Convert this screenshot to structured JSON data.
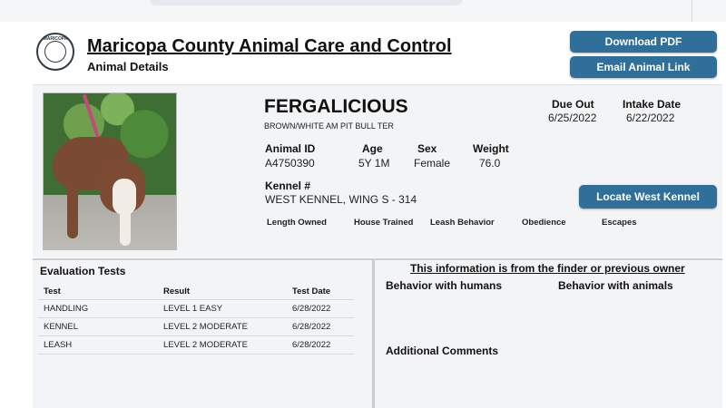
{
  "header": {
    "title": "Maricopa County Animal Care and Control",
    "subtitle": "Animal Details",
    "seal_text": "MARICOPA",
    "buttons": {
      "download_pdf": "Download PDF",
      "email_link": "Email Animal Link"
    }
  },
  "animal": {
    "name": "FERGALICIOUS",
    "breed": "BROWN/WHITE AM PIT BULL TER",
    "due_out_label": "Due Out",
    "due_out": "6/25/2022",
    "intake_label": "Intake Date",
    "intake": "6/22/2022",
    "id_label": "Animal ID",
    "id": "A4750390",
    "age_label": "Age",
    "age": "5Y 1M",
    "sex_label": "Sex",
    "sex": "Female",
    "weight_label": "Weight",
    "weight": "76.0",
    "kennel_label": "Kennel #",
    "kennel": "WEST KENNEL, WING S - 314",
    "locate_button": "Locate West Kennel",
    "extra_labels": [
      "Length Owned",
      "House Trained",
      "Leash Behavior",
      "Obedience",
      "Escapes"
    ]
  },
  "evaluation": {
    "title": "Evaluation Tests",
    "columns": [
      "Test",
      "Result",
      "Test Date"
    ],
    "rows": [
      [
        "HANDLING",
        "LEVEL 1 EASY",
        "6/28/2022"
      ],
      [
        "KENNEL",
        "LEVEL 2 MODERATE",
        "6/28/2022"
      ],
      [
        "LEASH",
        "LEVEL 2 MODERATE",
        "6/28/2022"
      ]
    ]
  },
  "finder": {
    "heading": "This information is from the finder or previous owner",
    "behavior_humans": "Behavior with humans",
    "behavior_animals": "Behavior with animals",
    "additional_comments": "Additional Comments"
  },
  "colors": {
    "button": "#2f6f9a",
    "panel": "#f3f4f6"
  }
}
